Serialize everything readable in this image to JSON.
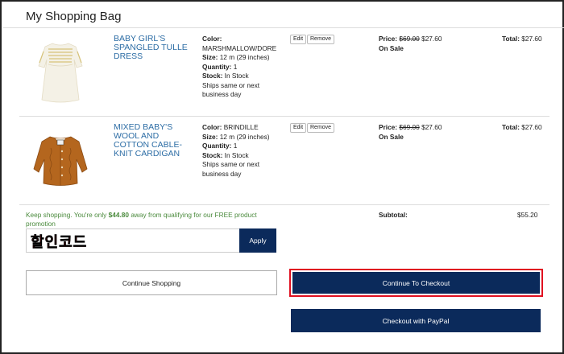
{
  "page": {
    "title": "My Shopping Bag"
  },
  "items": [
    {
      "name": "BABY GIRL'S SPANGLED TULLE DRESS",
      "color_label": "Color:",
      "color": "MARSHMALLOW/DORE",
      "size_label": "Size:",
      "size": "12 m (29 inches)",
      "quantity_label": "Quantity:",
      "quantity": "1",
      "stock_label": "Stock:",
      "stock": "In Stock",
      "shipping": "Ships same or next business day",
      "edit_label": "Edit",
      "remove_label": "Remove",
      "price_label": "Price:",
      "original_price": "$69.00",
      "sale_price": "$27.60",
      "sale_badge": "On Sale",
      "total_label": "Total:",
      "total": "$27.60"
    },
    {
      "name": "MIXED BABY'S WOOL AND COTTON CABLE-KNIT CARDIGAN",
      "color_label": "Color:",
      "color": "BRINDILLE",
      "size_label": "Size:",
      "size": "12 m (29 inches)",
      "quantity_label": "Quantity:",
      "quantity": "1",
      "stock_label": "Stock:",
      "stock": "In Stock",
      "shipping": "Ships same or next business day",
      "edit_label": "Edit",
      "remove_label": "Remove",
      "price_label": "Price:",
      "original_price": "$69.00",
      "sale_price": "$27.60",
      "sale_badge": "On Sale",
      "total_label": "Total:",
      "total": "$27.60"
    }
  ],
  "promo": {
    "prefix": "Keep shopping. You're only ",
    "amount": "$44.80",
    "suffix": " away from qualifying for our FREE product promotion"
  },
  "summary": {
    "subtotal_label": "Subtotal:",
    "subtotal": "$55.20"
  },
  "coupon": {
    "overlay_text": "할인코드",
    "apply_label": "Apply"
  },
  "actions": {
    "continue_label": "Continue Shopping",
    "checkout_label": "Continue To Checkout",
    "paypal_label": "Checkout with PayPal"
  },
  "colors": {
    "navy": "#0b2a5b",
    "link_blue": "#2d6da5",
    "promo_green": "#4a8a3c",
    "highlight_red": "#e01020"
  }
}
